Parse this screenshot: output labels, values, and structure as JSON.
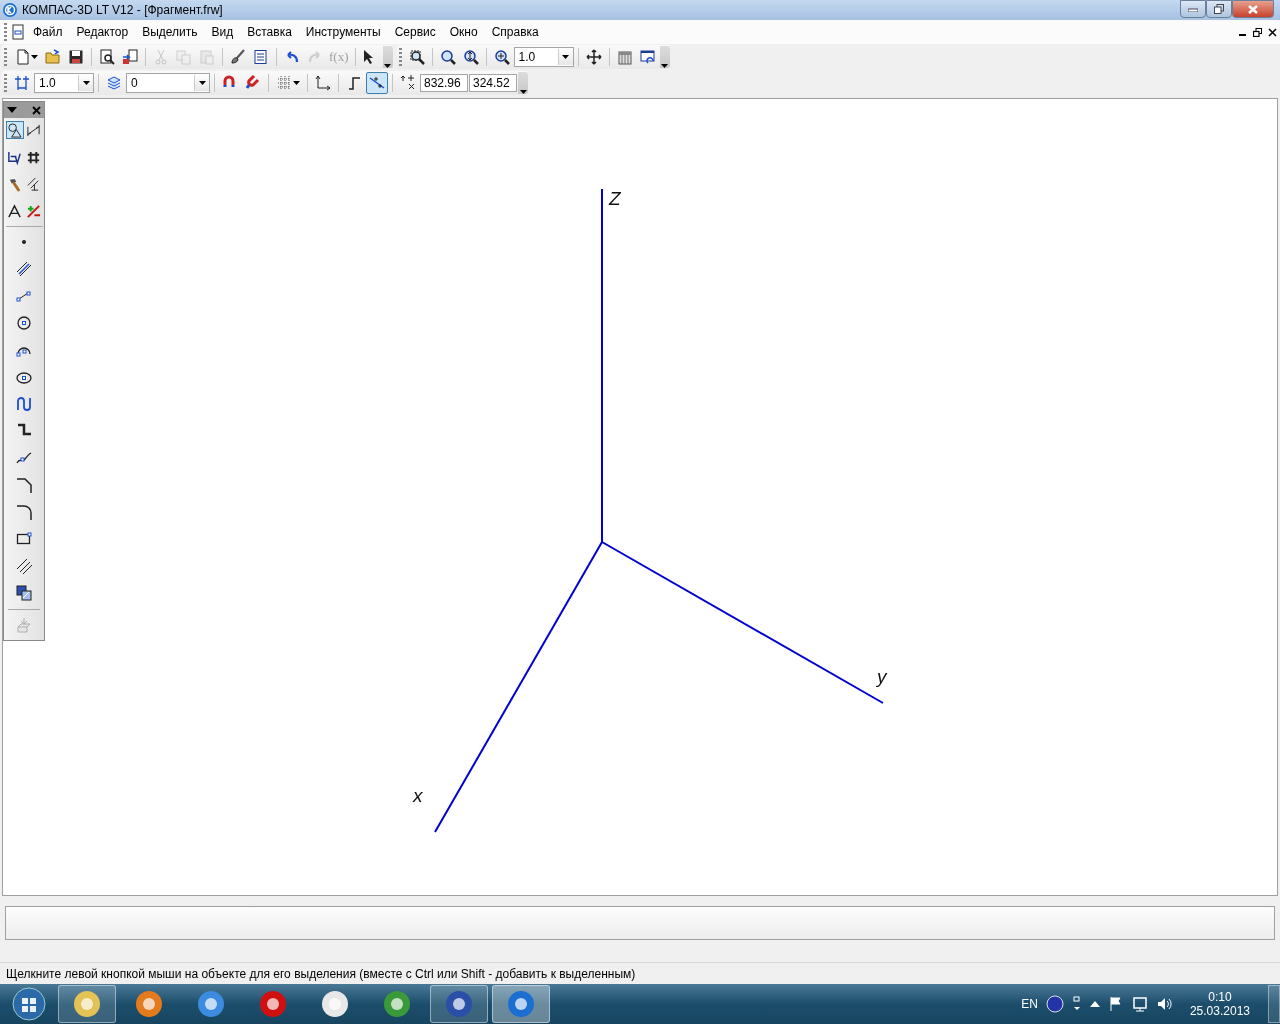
{
  "window": {
    "title": "КОМПАС-3D LT V12 - [Фрагмент.frw]"
  },
  "menu": [
    {
      "label": "Файл"
    },
    {
      "label": "Редактор"
    },
    {
      "label": "Выделить"
    },
    {
      "label": "Вид"
    },
    {
      "label": "Вставка"
    },
    {
      "label": "Инструменты"
    },
    {
      "label": "Сервис"
    },
    {
      "label": "Окно"
    },
    {
      "label": "Справка"
    }
  ],
  "toolbar_standard": [
    {
      "kind": "new",
      "disabled": false
    },
    {
      "kind": "open",
      "disabled": false
    },
    {
      "kind": "save",
      "disabled": false
    },
    {
      "kind": "separator"
    },
    {
      "kind": "preview",
      "disabled": false
    },
    {
      "kind": "manager",
      "disabled": false
    },
    {
      "kind": "separator"
    },
    {
      "kind": "cut",
      "disabled": true
    },
    {
      "kind": "copy",
      "disabled": true
    },
    {
      "kind": "paste",
      "disabled": true
    },
    {
      "kind": "separator"
    },
    {
      "kind": "brush",
      "disabled": false
    },
    {
      "kind": "table",
      "disabled": false
    },
    {
      "kind": "separator"
    },
    {
      "kind": "undo",
      "disabled": false
    },
    {
      "kind": "redo",
      "disabled": true
    },
    {
      "kind": "formula",
      "label": "f(x)",
      "disabled": true
    },
    {
      "kind": "separator"
    },
    {
      "kind": "help",
      "disabled": false
    },
    {
      "kind": "overflow"
    }
  ],
  "toolbar_view": [
    {
      "kind": "zoomwindow",
      "disabled": false
    },
    {
      "kind": "separator"
    },
    {
      "kind": "zoomin",
      "disabled": false
    },
    {
      "kind": "zoomout",
      "disabled": false
    },
    {
      "kind": "separator"
    },
    {
      "kind": "zoomscale",
      "disabled": false
    },
    {
      "kind": "combo",
      "value": "1.0"
    },
    {
      "kind": "separator"
    },
    {
      "kind": "pan",
      "disabled": false
    },
    {
      "kind": "separator"
    },
    {
      "kind": "rotate",
      "disabled": false
    },
    {
      "kind": "refresh",
      "disabled": false
    },
    {
      "kind": "overflow"
    }
  ],
  "toolbar_current": [
    {
      "kind": "step",
      "disabled": false
    },
    {
      "kind": "combo",
      "value": "1.0"
    },
    {
      "kind": "separator"
    },
    {
      "kind": "layers",
      "disabled": false
    },
    {
      "kind": "widecombo",
      "value": "0"
    },
    {
      "kind": "separator"
    },
    {
      "kind": "magnet",
      "disabled": false
    },
    {
      "kind": "magnet2",
      "disabled": false
    },
    {
      "kind": "separator"
    },
    {
      "kind": "grid",
      "disabled": false
    },
    {
      "kind": "separator"
    },
    {
      "kind": "axes",
      "disabled": false
    },
    {
      "kind": "separator"
    },
    {
      "kind": "ortho",
      "disabled": false,
      "pressed": false
    },
    {
      "kind": "snap",
      "disabled": false,
      "pressed": true
    },
    {
      "kind": "separator"
    },
    {
      "kind": "coords",
      "disabled": false
    },
    {
      "kind": "field",
      "value": "832.96"
    },
    {
      "kind": "field",
      "value": "324.52"
    },
    {
      "kind": "overflow"
    }
  ],
  "compact_panel": {
    "categories": [
      {
        "kind": "geometry",
        "selected": true
      },
      {
        "kind": "dimensions",
        "selected": false
      },
      {
        "kind": "symbols",
        "selected": false
      },
      {
        "kind": "parameters",
        "selected": false
      },
      {
        "kind": "editing",
        "selected": false
      },
      {
        "kind": "measure",
        "selected": false
      },
      {
        "kind": "select",
        "selected": false
      },
      {
        "kind": "attributes",
        "selected": false
      }
    ],
    "tools": [
      {
        "kind": "point"
      },
      {
        "kind": "auxline"
      },
      {
        "kind": "segment"
      },
      {
        "kind": "circle"
      },
      {
        "kind": "arc"
      },
      {
        "kind": "ellipse"
      },
      {
        "kind": "spline"
      },
      {
        "kind": "polyline"
      },
      {
        "kind": "bezier"
      },
      {
        "kind": "chamfer"
      },
      {
        "kind": "fillet"
      },
      {
        "kind": "rectangle"
      },
      {
        "kind": "equidistant"
      },
      {
        "kind": "hatch"
      }
    ],
    "footer_tool": {
      "disabled": true
    }
  },
  "canvas": {
    "axes": [
      {
        "kind": "z",
        "label": "Z"
      },
      {
        "kind": "y",
        "label": "y"
      },
      {
        "kind": "x",
        "label": "x"
      }
    ]
  },
  "status_bar": {
    "hint": "Щелкните левой кнопкой мыши на объекте для его выделения (вместе с Ctrl или Shift - добавить к выделенным)"
  },
  "taskbar": {
    "apps": [
      {
        "kind": "explorer",
        "running": true,
        "selected": false
      },
      {
        "kind": "media",
        "running": false,
        "selected": false
      },
      {
        "kind": "mail",
        "running": false,
        "selected": false
      },
      {
        "kind": "opera",
        "running": false,
        "selected": false
      },
      {
        "kind": "yandex",
        "running": false,
        "selected": false
      },
      {
        "kind": "chrome",
        "running": false,
        "selected": false
      },
      {
        "kind": "word",
        "running": true,
        "selected": false
      },
      {
        "kind": "kompas",
        "running": true,
        "selected": true
      }
    ],
    "language": "EN",
    "time": "0:10",
    "date": "25.03.2013"
  }
}
